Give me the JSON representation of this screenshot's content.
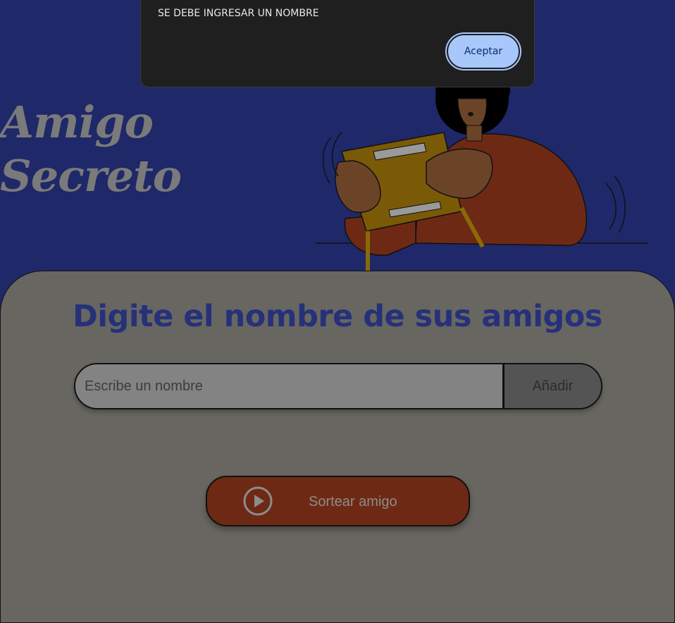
{
  "header": {
    "title_line1": "Amigo",
    "title_line2": "Secreto"
  },
  "main": {
    "section_title": "Digite el nombre de sus amigos",
    "input": {
      "placeholder": "Escribe un nombre",
      "value": ""
    },
    "add_label": "Añadir",
    "draw_label": "Sortear amigo",
    "draw_icon": "play-circle-icon"
  },
  "dialog": {
    "message": "SE DEBE INGRESAR UN NOMBRE",
    "accept_label": "Aceptar"
  },
  "colors": {
    "background": "#1f2868",
    "card": "#676660",
    "title": "#26317a",
    "draw_button": "#6e2914",
    "accept_button": "#a8c7fa"
  }
}
